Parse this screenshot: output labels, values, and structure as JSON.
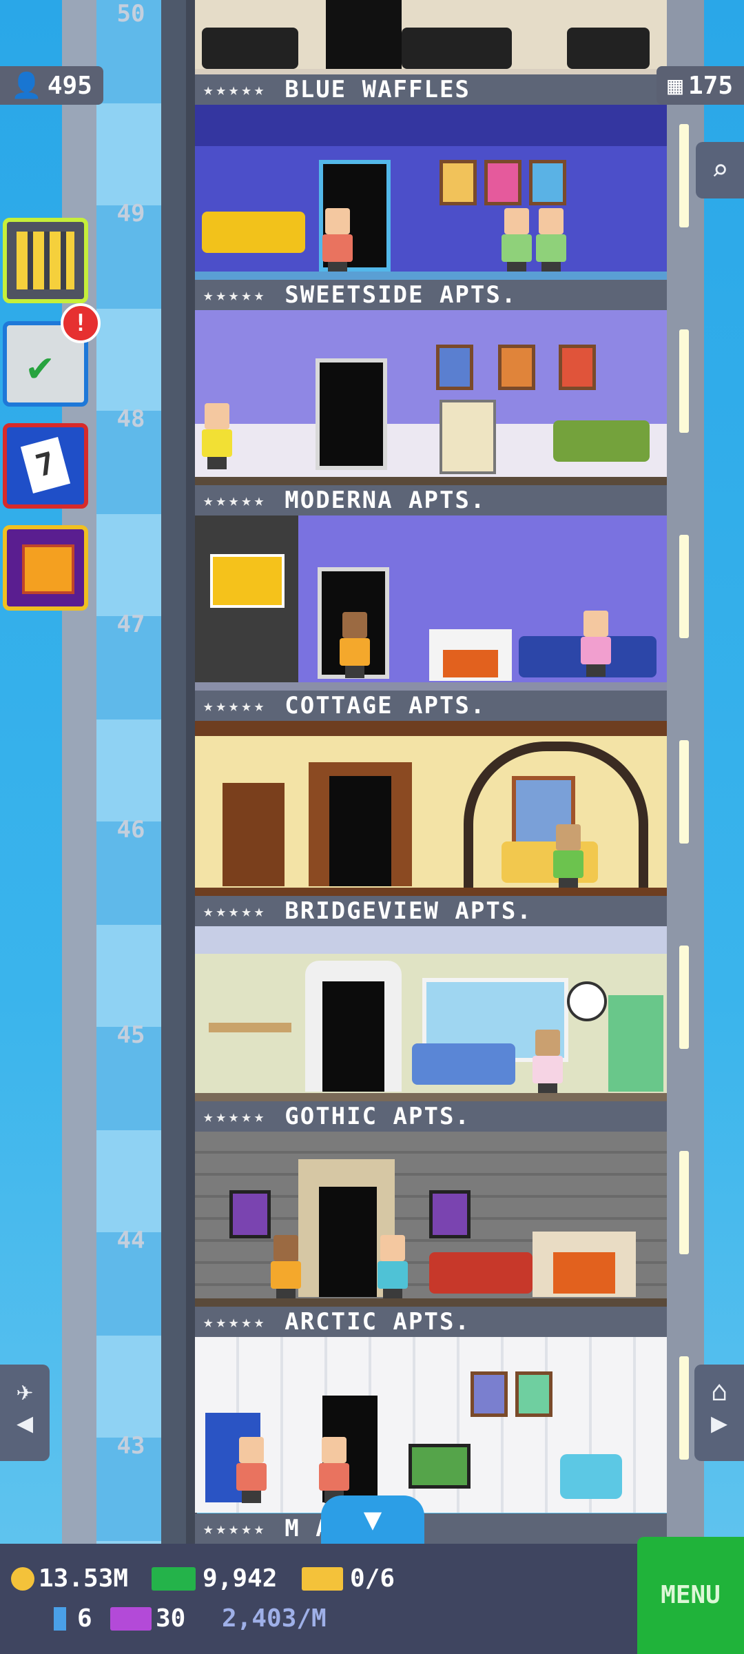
{
  "hud_top": {
    "population": "495",
    "floors": "175"
  },
  "top_floor": {
    "number": "50",
    "name": "BLUE WAFFLES",
    "stars": "★★★★★"
  },
  "floors": [
    {
      "number": "49",
      "name": "SWEETSIDE APTS.",
      "stars": "★★★★★"
    },
    {
      "number": "48",
      "name": "MODERNA APTS.",
      "stars": "★★★★★"
    },
    {
      "number": "47",
      "name": "COTTAGE APTS.",
      "stars": "★★★★★"
    },
    {
      "number": "46",
      "name": "BRIDGEVIEW APTS.",
      "stars": "★★★★★"
    },
    {
      "number": "45",
      "name": "GOTHIC APTS.",
      "stars": "★★★★★"
    },
    {
      "number": "44",
      "name": "ARCTIC APTS.",
      "stars": "★★★★★"
    },
    {
      "number": "43",
      "name": "M    APTS.",
      "stars": "★★★★★"
    }
  ],
  "side_buttons": {
    "alert": "!",
    "calendar_day": "7"
  },
  "nav": {
    "left_arrow": "◀",
    "right_arrow": "▶",
    "left_icon": "✈",
    "right_icon": "⌂",
    "down_arrow": "▼"
  },
  "hud": {
    "coins": "13.53M",
    "bux": "9,942",
    "tickets": "0/6",
    "keys": "6",
    "bitizen_rate_icon_value": "30",
    "rate": "2,403/M",
    "menu_label": "MENU"
  },
  "colors": {
    "menu_green": "#20b33a",
    "hud_bg": "#3f4560",
    "sky": "#2fa9e6"
  }
}
